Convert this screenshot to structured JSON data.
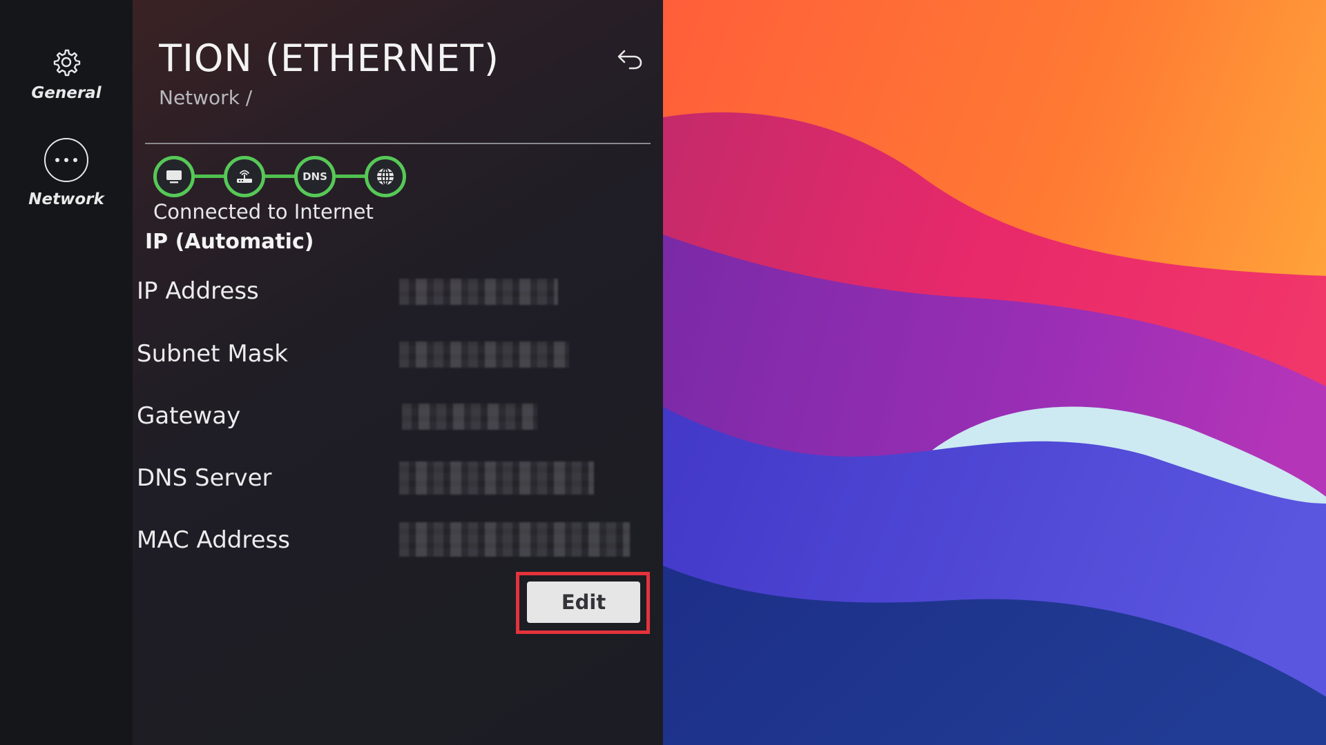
{
  "nav": {
    "items": [
      {
        "label": "General",
        "icon": "gear-icon"
      },
      {
        "label": "Network",
        "icon": "more-icon"
      }
    ]
  },
  "panel": {
    "title": "TION (ETHERNET)",
    "breadcrumb": "Network /",
    "connection_status": "Connected to Internet",
    "chain_nodes": [
      "tv-icon",
      "router-icon",
      "DNS",
      "globe-icon"
    ],
    "section_header": "IP (Automatic)",
    "rows": [
      {
        "label": "IP Address",
        "value": ""
      },
      {
        "label": "Subnet Mask",
        "value": ""
      },
      {
        "label": "Gateway",
        "value": ""
      },
      {
        "label": "DNS Server",
        "value": ""
      },
      {
        "label": "MAC Address",
        "value": ""
      }
    ],
    "edit_label": "Edit"
  },
  "colors": {
    "status_green": "#57c857",
    "highlight_red": "#e4333b",
    "panel_bg": "#1f1d25",
    "rail_bg": "#15161a"
  }
}
